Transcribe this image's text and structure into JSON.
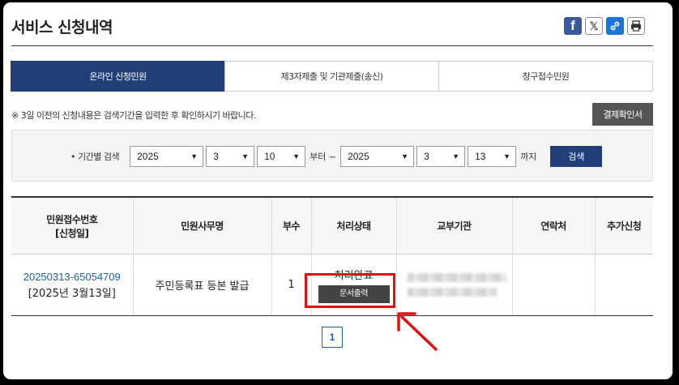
{
  "header": {
    "title": "서비스 신청내역",
    "share_icons": [
      "facebook-icon",
      "x-icon",
      "link-icon",
      "print-icon"
    ],
    "facebook_glyph": "f",
    "x_glyph": "𝕏"
  },
  "tabs": [
    {
      "label": "온라인 신청민원",
      "active": true
    },
    {
      "label": "제3자제출 및 기관제출(송신)",
      "active": false
    },
    {
      "label": "창구접수민원",
      "active": false
    }
  ],
  "notice": "※ 3일 이전의 신청내용은 검색기간을 입력한 후 확인하시기 바랍니다.",
  "receipt_button": "결제확인서",
  "search": {
    "label": "• 기간별 검색",
    "from": {
      "year": "2025",
      "month": "3",
      "day": "10"
    },
    "from_suffix": "부터 ~",
    "to": {
      "year": "2025",
      "month": "3",
      "day": "13"
    },
    "to_suffix": "까지",
    "button": "검색"
  },
  "table": {
    "headers": {
      "app_no_line1": "민원접수번호",
      "app_no_line2": "[신청일]",
      "service": "민원사무명",
      "copies": "부수",
      "status": "처리상태",
      "agency": "교부기관",
      "contact": "연락처",
      "extra": "추가신청"
    },
    "rows": [
      {
        "app_no": "20250313-65054709",
        "app_date": "[2025년 3월13일]",
        "service": "주민등록표 등본 발급",
        "copies": "1",
        "status": "처리완료",
        "print_button": "문서출력",
        "agency": "",
        "contact": "",
        "extra": ""
      }
    ]
  },
  "pagination": {
    "current": "1"
  },
  "colors": {
    "primary": "#233f7a",
    "highlight": "#e01010",
    "link": "#1f5fa8"
  }
}
